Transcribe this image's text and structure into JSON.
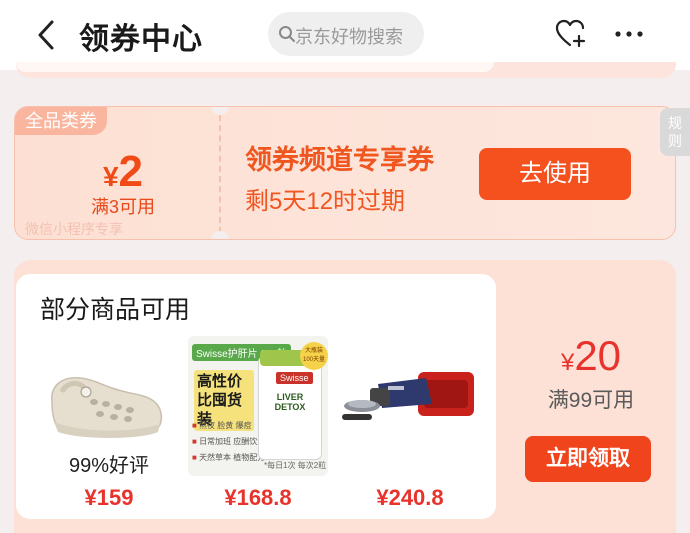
{
  "header": {
    "title": "领券中心",
    "search_placeholder": "京东好物搜索"
  },
  "coupon": {
    "tag": "全品类券",
    "currency": "¥",
    "amount": "2",
    "condition": "满3可用",
    "wechat_note": "微信小程序专享",
    "name": "领券频道专享券",
    "expire": "剩5天12时过期",
    "use_button": "去使用"
  },
  "rules_tab": "规则",
  "product_coupon": {
    "title": "部分商品可用",
    "products": [
      {
        "name": "clogs-shoe",
        "rating": "99%好评",
        "price": "¥159"
      },
      {
        "name": "swisse-liver-detox",
        "price": "¥168.8"
      },
      {
        "name": "angle-grinder",
        "price": "¥240.8"
      }
    ],
    "currency": "¥",
    "amount": "20",
    "condition": "满99可用",
    "claim_button": "立即领取"
  },
  "supplement_pack": {
    "brand": "Swisse护肝片 200粒",
    "slogan": "高性价比囤货装",
    "features": [
      "熬夜 脸黄 爆痘",
      "日常加班 应酬饮酒",
      "天然草本 植物配方"
    ],
    "jar_logo": "Swisse",
    "jar_label": "LIVER DETOX",
    "badge": "大瓶装 100天量",
    "foot": "*每日1次 每次2粒"
  },
  "colors": {
    "accent": "#f4511f",
    "price_red": "#e8332c",
    "card_bg": "#fde1d6"
  },
  "icons": [
    "back-arrow-icon",
    "search-icon",
    "favorite-heart-plus-icon",
    "more-dots-icon"
  ]
}
